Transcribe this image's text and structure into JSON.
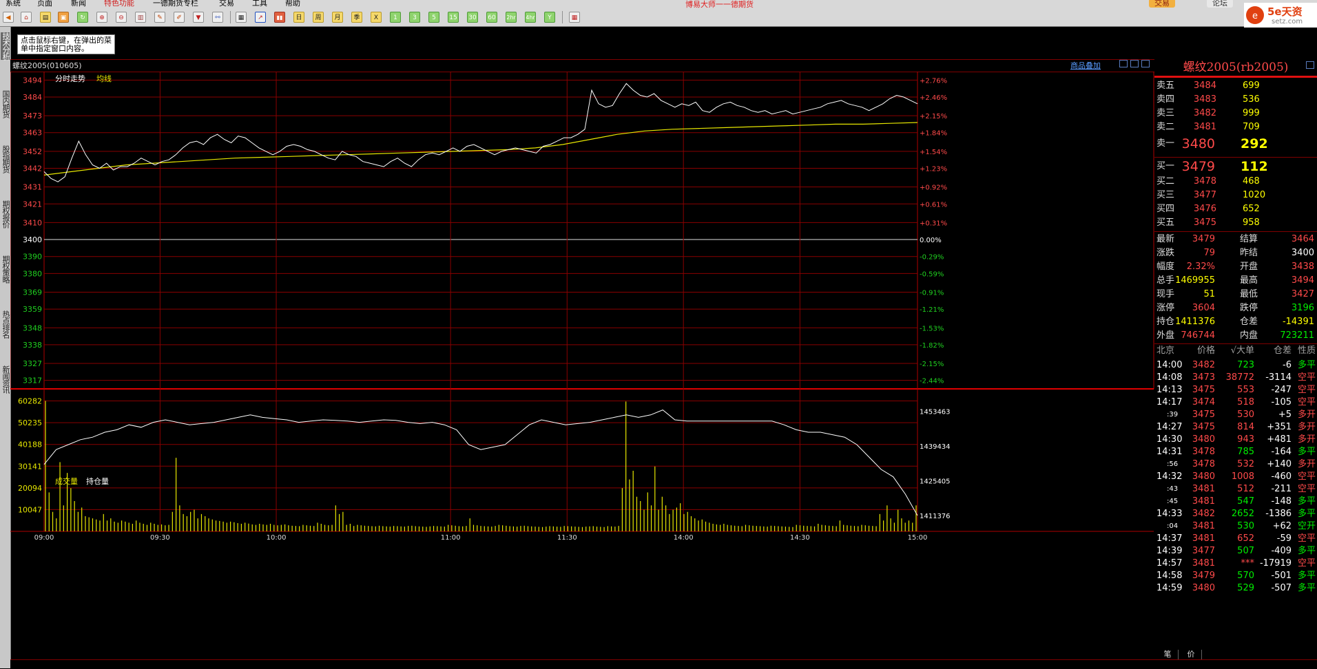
{
  "menu": {
    "items": [
      "系统",
      "页面",
      "新闻",
      "特色功能",
      "一德期货专栏",
      "交易",
      "工具",
      "帮助"
    ],
    "app_title": "博易大师一一德期货",
    "trade_button": "交易",
    "forum_button": "论坛"
  },
  "logo": {
    "brand": "5e天资",
    "url": "setz.com"
  },
  "toolbar": {
    "period_buttons": [
      "日",
      "周",
      "月",
      "季",
      "1",
      "3",
      "5",
      "15",
      "30",
      "60",
      "2hr",
      "4hr"
    ]
  },
  "left_tabs": [
    "技术分析",
    "国内期货",
    "股指期货",
    "期权报价",
    "期权策略",
    "热点排名",
    "新闻资讯"
  ],
  "hint": {
    "text": "点击鼠标右键，在弹出的菜单中指定窗口内容。"
  },
  "chart_header": {
    "symbol": "螺纹2005(010605)",
    "overlay_link": "商品叠加"
  },
  "price_panel": {
    "labels": [
      "分时走势",
      "均线"
    ],
    "left_ticks": [
      "3494",
      "3484",
      "3473",
      "3463",
      "3452",
      "3442",
      "3431",
      "3421",
      "3410",
      "3400",
      "3390",
      "3380",
      "3369",
      "3359",
      "3348",
      "3338",
      "3327",
      "3317"
    ],
    "right_ticks": [
      "+2.76%",
      "+2.46%",
      "+2.15%",
      "+1.84%",
      "+1.54%",
      "+1.23%",
      "+0.92%",
      "+0.61%",
      "+0.31%",
      "0.00%",
      "-0.29%",
      "-0.59%",
      "-0.91%",
      "-1.21%",
      "-1.53%",
      "-1.82%",
      "-2.15%",
      "-2.44%"
    ]
  },
  "volume_panel": {
    "labels": [
      "成交量",
      "持仓量"
    ],
    "left_ticks": [
      "60282",
      "50235",
      "40188",
      "30141",
      "20094",
      "10047"
    ],
    "right_ticks": [
      "1453463",
      "1439434",
      "1425405",
      "1411376"
    ]
  },
  "time_axis": [
    "09:00",
    "09:30",
    "10:00",
    "11:00",
    "11:30",
    "14:00",
    "14:30",
    "15:00"
  ],
  "chart_data": [
    {
      "type": "line",
      "title": "分时走势",
      "x_range": [
        "09:00",
        "15:00"
      ],
      "ylim": [
        3312,
        3499
      ],
      "reference_price": 3400,
      "series": [
        {
          "name": "分时走势",
          "color": "#ffffff",
          "values": [
            3440,
            3436,
            3434,
            3437,
            3448,
            3458,
            3450,
            3444,
            3442,
            3445,
            3441,
            3443,
            3443,
            3445,
            3448,
            3446,
            3444,
            3446,
            3447,
            3450,
            3454,
            3457,
            3458,
            3456,
            3460,
            3462,
            3459,
            3457,
            3461,
            3460,
            3457,
            3454,
            3452,
            3450,
            3452,
            3455,
            3456,
            3455,
            3453,
            3452,
            3450,
            3448,
            3447,
            3452,
            3450,
            3449,
            3446,
            3445,
            3444,
            3443,
            3446,
            3448,
            3445,
            3443,
            3447,
            3450,
            3451,
            3450,
            3452,
            3454,
            3452,
            3455,
            3456,
            3454,
            3452,
            3450,
            3452,
            3453,
            3454,
            3453,
            3452,
            3451,
            3455,
            3456,
            3458,
            3460,
            3460,
            3462,
            3465,
            3488,
            3480,
            3478,
            3479,
            3486,
            3492,
            3488,
            3485,
            3484,
            3486,
            3482,
            3480,
            3478,
            3480,
            3479,
            3481,
            3476,
            3475,
            3478,
            3480,
            3481,
            3479,
            3478,
            3476,
            3475,
            3476,
            3474,
            3475,
            3476,
            3474,
            3475,
            3476,
            3477,
            3478,
            3480,
            3481,
            3482,
            3480,
            3479,
            3478,
            3476,
            3478,
            3480,
            3483,
            3485,
            3484,
            3482,
            3480
          ]
        },
        {
          "name": "均线",
          "color": "#e8e800",
          "values": [
            3438,
            3440,
            3442,
            3444,
            3445,
            3446,
            3447,
            3448,
            3448.5,
            3449,
            3449.5,
            3450,
            3450.5,
            3451,
            3451.5,
            3452,
            3452.5,
            3453,
            3454,
            3456,
            3459,
            3462,
            3464,
            3465,
            3465.5,
            3466,
            3466.5,
            3467,
            3467.5,
            3468,
            3468,
            3468.5,
            3469
          ]
        }
      ]
    },
    {
      "type": "bar",
      "title": "成交量",
      "x_range": [
        "09:00",
        "15:00"
      ],
      "ylim": [
        0,
        63000
      ],
      "series": [
        {
          "name": "成交量",
          "color": "#e8e800",
          "values": [
            60282,
            18000,
            9000,
            6000,
            32000,
            12000,
            27000,
            20000,
            14000,
            9000,
            11000,
            7000,
            6500,
            6000,
            5500,
            5000,
            8000,
            5000,
            6000,
            4500,
            4000,
            5000,
            4500,
            4000,
            3500,
            5000,
            4000,
            3500,
            3000,
            4000,
            3500,
            3000,
            3200,
            2800,
            3000,
            9000,
            34000,
            12000,
            8000,
            7000,
            9000,
            10000,
            6000,
            8000,
            7000,
            6000,
            5500,
            5000,
            4800,
            4500,
            4000,
            4500,
            4200,
            3800,
            3500,
            4000,
            3600,
            3200,
            3000,
            3500,
            3200,
            3000,
            3500,
            3000,
            2800,
            3000,
            3200,
            2800,
            2600,
            2500,
            2400,
            3000,
            2800,
            2600,
            2500,
            4000,
            3500,
            3000,
            2800,
            3000,
            12000,
            8000,
            9000,
            3000,
            3500,
            2500,
            3000,
            2800,
            2600,
            2500,
            2400,
            2300,
            2600,
            2400,
            2300,
            2200,
            2500,
            2400,
            2300,
            2200,
            2500,
            2600,
            2400,
            2300,
            2200,
            2100,
            2300,
            2500,
            2400,
            2300,
            2200,
            3000,
            2800,
            2600,
            2400,
            2300,
            2500,
            6000,
            3000,
            2800,
            2500,
            2400,
            2300,
            2200,
            2500,
            3000,
            2800,
            2600,
            2400,
            2300,
            2200,
            2500,
            2600,
            2400,
            2300,
            2200,
            2100,
            2000,
            2200,
            2400,
            2300,
            2200,
            2100,
            2500,
            2400,
            2300,
            2200,
            2100,
            2000,
            2200,
            2300,
            2400,
            2200,
            2100,
            2000,
            2400,
            2300,
            2200,
            2500,
            20000,
            60000,
            24000,
            28000,
            16000,
            14000,
            10000,
            18000,
            12000,
            30000,
            10000,
            16000,
            12000,
            8000,
            10000,
            11000,
            13000,
            8000,
            9000,
            7000,
            6000,
            5000,
            5500,
            4500,
            4000,
            3500,
            3200,
            3000,
            3500,
            3000,
            2800,
            2600,
            2500,
            2400,
            3000,
            2800,
            2600,
            2500,
            2400,
            2300,
            2200,
            2600,
            2500,
            2400,
            2300,
            2200,
            2100,
            2000,
            3000,
            2800,
            2600,
            2500,
            2400,
            2300,
            3500,
            3000,
            2800,
            2600,
            2500,
            2400,
            5000,
            3000,
            2800,
            2600,
            2500,
            2400,
            3000,
            2800,
            2600,
            2500,
            2400,
            8000,
            5000,
            12000,
            6000,
            4000,
            10000,
            6000,
            4000,
            5000,
            4000,
            12000
          ]
        }
      ]
    },
    {
      "type": "line",
      "title": "持仓量",
      "x_range": [
        "09:00",
        "15:00"
      ],
      "ylim": [
        1405000,
        1460000
      ],
      "series": [
        {
          "name": "持仓量",
          "color": "#ffffff",
          "values": [
            1432000,
            1438000,
            1440000,
            1442000,
            1443000,
            1445000,
            1446000,
            1448000,
            1447000,
            1449000,
            1450000,
            1449000,
            1448000,
            1448500,
            1449000,
            1450000,
            1451000,
            1452000,
            1451000,
            1450500,
            1450000,
            1449000,
            1449500,
            1450000,
            1449800,
            1449500,
            1449000,
            1449500,
            1450000,
            1449800,
            1449000,
            1448500,
            1449000,
            1448000,
            1446000,
            1440000,
            1438000,
            1439000,
            1440000,
            1444000,
            1448000,
            1450000,
            1449000,
            1448000,
            1448500,
            1449000,
            1450000,
            1451000,
            1452000,
            1451000,
            1452000,
            1454000,
            1450000,
            1449500,
            1449500,
            1449500,
            1449500,
            1449500,
            1449500,
            1449500,
            1449500,
            1448000,
            1446000,
            1445000,
            1445000,
            1444000,
            1443000,
            1440000,
            1435000,
            1430000,
            1427000,
            1420000,
            1411376
          ]
        }
      ]
    }
  ],
  "quote": {
    "title": "螺纹2005(rb2005)",
    "asks": [
      {
        "label": "卖五",
        "price": "3484",
        "vol": "699"
      },
      {
        "label": "卖四",
        "price": "3483",
        "vol": "536"
      },
      {
        "label": "卖三",
        "price": "3482",
        "vol": "999"
      },
      {
        "label": "卖二",
        "price": "3481",
        "vol": "709"
      },
      {
        "label": "卖一",
        "price": "3480",
        "vol": "292"
      }
    ],
    "bids": [
      {
        "label": "买一",
        "price": "3479",
        "vol": "112"
      },
      {
        "label": "买二",
        "price": "3478",
        "vol": "468"
      },
      {
        "label": "买三",
        "price": "3477",
        "vol": "1020"
      },
      {
        "label": "买四",
        "price": "3476",
        "vol": "652"
      },
      {
        "label": "买五",
        "price": "3475",
        "vol": "958"
      }
    ],
    "stats": [
      {
        "l1": "最新",
        "v1": "3479",
        "c1": "#ff4a4a",
        "l2": "结算",
        "v2": "3464",
        "c2": "#ff4a4a"
      },
      {
        "l1": "涨跌",
        "v1": "79",
        "c1": "#ff4a4a",
        "l2": "昨结",
        "v2": "3400",
        "c2": "#ffffff"
      },
      {
        "l1": "幅度",
        "v1": "2.32%",
        "c1": "#ff4a4a",
        "l2": "开盘",
        "v2": "3438",
        "c2": "#ff4a4a"
      },
      {
        "l1": "总手",
        "v1": "1469955",
        "c1": "#ffff00",
        "l2": "最高",
        "v2": "3494",
        "c2": "#ff4a4a"
      },
      {
        "l1": "现手",
        "v1": "51",
        "c1": "#ffff00",
        "l2": "最低",
        "v2": "3427",
        "c2": "#ff4a4a"
      },
      {
        "l1": "涨停",
        "v1": "3604",
        "c1": "#ff4a4a",
        "l2": "跌停",
        "v2": "3196",
        "c2": "#00ee00"
      },
      {
        "l1": "持仓",
        "v1": "1411376",
        "c1": "#ffff00",
        "l2": "仓差",
        "v2": "-14391",
        "c2": "#ffff00"
      },
      {
        "l1": "外盘",
        "v1": "746744",
        "c1": "#ff4a4a",
        "l2": "内盘",
        "v2": "723211",
        "c2": "#00ee00"
      }
    ],
    "ticks_header": {
      "time": "北京",
      "price": "价格",
      "size": "√大单",
      "oi": "仓差",
      "nature": "性质"
    },
    "ticks": [
      {
        "time": "14:00",
        "price": "3482",
        "size": "723",
        "oi": "-6",
        "nature": "多平",
        "pc": "#ff4a4a",
        "sc": "#00ee00",
        "nc": "#00ee00"
      },
      {
        "time": "14:08",
        "price": "3473",
        "size": "38772",
        "oi": "-3114",
        "nature": "空平",
        "pc": "#ff4a4a",
        "sc": "#ff4a4a",
        "nc": "#ff4a4a"
      },
      {
        "time": "14:13",
        "price": "3475",
        "size": "553",
        "oi": "-247",
        "nature": "空平",
        "pc": "#ff4a4a",
        "sc": "#ff4a4a",
        "nc": "#ff4a4a"
      },
      {
        "time": "14:17",
        "price": "3474",
        "size": "518",
        "oi": "-105",
        "nature": "空平",
        "pc": "#ff4a4a",
        "sc": "#ff4a4a",
        "nc": "#ff4a4a"
      },
      {
        "time": ":39",
        "price": "3475",
        "size": "530",
        "oi": "+5",
        "nature": "多开",
        "pc": "#ff4a4a",
        "sc": "#ff4a4a",
        "nc": "#ff4a4a"
      },
      {
        "time": "14:27",
        "price": "3475",
        "size": "814",
        "oi": "+351",
        "nature": "多开",
        "pc": "#ff4a4a",
        "sc": "#ff4a4a",
        "nc": "#ff4a4a"
      },
      {
        "time": "14:30",
        "price": "3480",
        "size": "943",
        "oi": "+481",
        "nature": "多开",
        "pc": "#ff4a4a",
        "sc": "#ff4a4a",
        "nc": "#ff4a4a"
      },
      {
        "time": "14:31",
        "price": "3478",
        "size": "785",
        "oi": "-164",
        "nature": "多平",
        "pc": "#ff4a4a",
        "sc": "#00ee00",
        "nc": "#00ee00"
      },
      {
        "time": ":56",
        "price": "3478",
        "size": "532",
        "oi": "+140",
        "nature": "多开",
        "pc": "#ff4a4a",
        "sc": "#ff4a4a",
        "nc": "#ff4a4a"
      },
      {
        "time": "14:32",
        "price": "3480",
        "size": "1008",
        "oi": "-460",
        "nature": "空平",
        "pc": "#ff4a4a",
        "sc": "#ff4a4a",
        "nc": "#ff4a4a"
      },
      {
        "time": ":43",
        "price": "3481",
        "size": "512",
        "oi": "-211",
        "nature": "空平",
        "pc": "#ff4a4a",
        "sc": "#ff4a4a",
        "nc": "#ff4a4a"
      },
      {
        "time": ":45",
        "price": "3481",
        "size": "547",
        "oi": "-148",
        "nature": "多平",
        "pc": "#ff4a4a",
        "sc": "#00ee00",
        "nc": "#00ee00"
      },
      {
        "time": "14:33",
        "price": "3482",
        "size": "2652",
        "oi": "-1386",
        "nature": "多平",
        "pc": "#ff4a4a",
        "sc": "#00ee00",
        "nc": "#00ee00"
      },
      {
        "time": ":04",
        "price": "3481",
        "size": "530",
        "oi": "+62",
        "nature": "空开",
        "pc": "#ff4a4a",
        "sc": "#00ee00",
        "nc": "#00ee00"
      },
      {
        "time": "14:37",
        "price": "3481",
        "size": "652",
        "oi": "-59",
        "nature": "空平",
        "pc": "#ff4a4a",
        "sc": "#ff4a4a",
        "nc": "#ff4a4a"
      },
      {
        "time": "14:39",
        "price": "3477",
        "size": "507",
        "oi": "-409",
        "nature": "多平",
        "pc": "#ff4a4a",
        "sc": "#00ee00",
        "nc": "#00ee00"
      },
      {
        "time": "14:57",
        "price": "3481",
        "size": "***",
        "oi": "-17919",
        "nature": "空平",
        "pc": "#ff4a4a",
        "sc": "#ff4a4a",
        "nc": "#ff4a4a"
      },
      {
        "time": "14:58",
        "price": "3479",
        "size": "570",
        "oi": "-501",
        "nature": "多平",
        "pc": "#ff4a4a",
        "sc": "#00ee00",
        "nc": "#00ee00"
      },
      {
        "time": "14:59",
        "price": "3480",
        "size": "529",
        "oi": "-507",
        "nature": "多平",
        "pc": "#ff4a4a",
        "sc": "#00ee00",
        "nc": "#00ee00"
      }
    ],
    "bottom_tabs": [
      "笔",
      "价"
    ]
  }
}
